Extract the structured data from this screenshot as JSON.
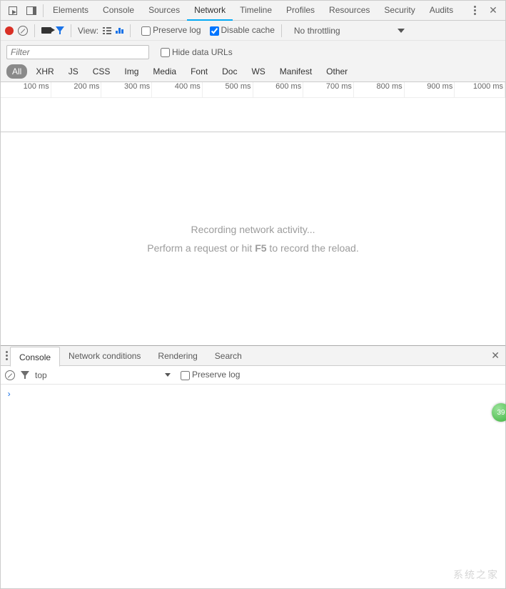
{
  "top_tabs": {
    "items": [
      "Elements",
      "Console",
      "Sources",
      "Network",
      "Timeline",
      "Profiles",
      "Resources",
      "Security",
      "Audits"
    ],
    "active_index": 3
  },
  "network_toolbar": {
    "view_label": "View:",
    "preserve_log_label": "Preserve log",
    "preserve_log_checked": false,
    "disable_cache_label": "Disable cache",
    "disable_cache_checked": true,
    "throttling_label": "No throttling"
  },
  "filter": {
    "placeholder": "Filter",
    "hide_data_urls_label": "Hide data URLs",
    "hide_data_urls_checked": false
  },
  "type_filters": [
    "All",
    "XHR",
    "JS",
    "CSS",
    "Img",
    "Media",
    "Font",
    "Doc",
    "WS",
    "Manifest",
    "Other"
  ],
  "timeline_ticks": [
    "100 ms",
    "200 ms",
    "300 ms",
    "400 ms",
    "500 ms",
    "600 ms",
    "700 ms",
    "800 ms",
    "900 ms",
    "1000 ms"
  ],
  "empty_state": {
    "line1": "Recording network activity...",
    "line2_pre": "Perform a request or hit ",
    "line2_key": "F5",
    "line2_post": " to record the reload."
  },
  "drawer": {
    "tabs": [
      "Console",
      "Network conditions",
      "Rendering",
      "Search"
    ],
    "active_index": 0
  },
  "console_toolbar": {
    "context_label": "top",
    "preserve_log_label": "Preserve log",
    "preserve_log_checked": false
  },
  "console": {
    "prompt": "›"
  },
  "badge": {
    "value": "39"
  },
  "watermark": "系统之家"
}
